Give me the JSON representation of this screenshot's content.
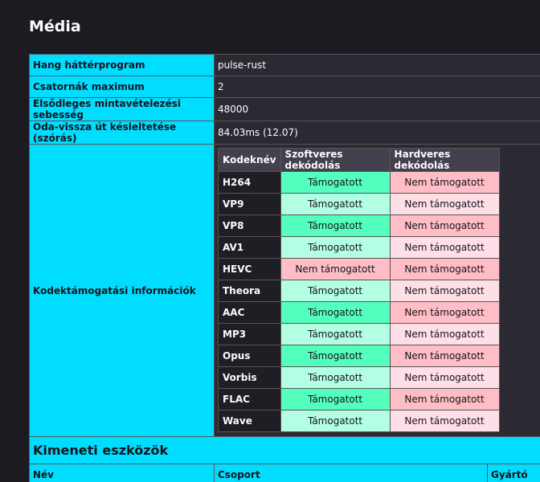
{
  "page_title": "Média",
  "rows": [
    {
      "label": "Hang háttérprogram",
      "value": "pulse-rust"
    },
    {
      "label": "Csatornák maximum",
      "value": "2"
    },
    {
      "label": "Elsődleges mintavételezési sebesség",
      "value": "48000"
    },
    {
      "label": "Oda-vissza út késleltetése (szórás)",
      "value": "84.03ms (12.07)"
    }
  ],
  "codec_section": {
    "label": "Kodektámogatási információk",
    "headers": [
      "Kodeknév",
      "Szoftveres dekódolás",
      "Hardveres dekódolás"
    ],
    "codecs": [
      {
        "name": "H264",
        "software": "Támogatott",
        "hardware": "Nem támogatott",
        "sw_supported": true,
        "hw_supported": false
      },
      {
        "name": "VP9",
        "software": "Támogatott",
        "hardware": "Nem támogatott",
        "sw_supported": true,
        "hw_supported": false
      },
      {
        "name": "VP8",
        "software": "Támogatott",
        "hardware": "Nem támogatott",
        "sw_supported": true,
        "hw_supported": false
      },
      {
        "name": "AV1",
        "software": "Támogatott",
        "hardware": "Nem támogatott",
        "sw_supported": true,
        "hw_supported": false
      },
      {
        "name": "HEVC",
        "software": "Nem támogatott",
        "hardware": "Nem támogatott",
        "sw_supported": false,
        "hw_supported": false
      },
      {
        "name": "Theora",
        "software": "Támogatott",
        "hardware": "Nem támogatott",
        "sw_supported": true,
        "hw_supported": false
      },
      {
        "name": "AAC",
        "software": "Támogatott",
        "hardware": "Nem támogatott",
        "sw_supported": true,
        "hw_supported": false
      },
      {
        "name": "MP3",
        "software": "Támogatott",
        "hardware": "Nem támogatott",
        "sw_supported": true,
        "hw_supported": false
      },
      {
        "name": "Opus",
        "software": "Támogatott",
        "hardware": "Nem támogatott",
        "sw_supported": true,
        "hw_supported": false
      },
      {
        "name": "Vorbis",
        "software": "Támogatott",
        "hardware": "Nem támogatott",
        "sw_supported": true,
        "hw_supported": false
      },
      {
        "name": "FLAC",
        "software": "Támogatott",
        "hardware": "Nem támogatott",
        "sw_supported": true,
        "hw_supported": false
      },
      {
        "name": "Wave",
        "software": "Támogatott",
        "hardware": "Nem támogatott",
        "sw_supported": true,
        "hw_supported": false
      }
    ]
  },
  "output_section": {
    "title": "Kimeneti eszközök",
    "columns": [
      "Név",
      "Csoport",
      "Gyártó"
    ]
  },
  "colors": {
    "accent": "#00ddff",
    "supported_strong": "#54ffbd",
    "supported_light": "#b3ffe3",
    "unsupported_strong": "#ffbdc5",
    "unsupported_light": "#ffdfe7"
  }
}
